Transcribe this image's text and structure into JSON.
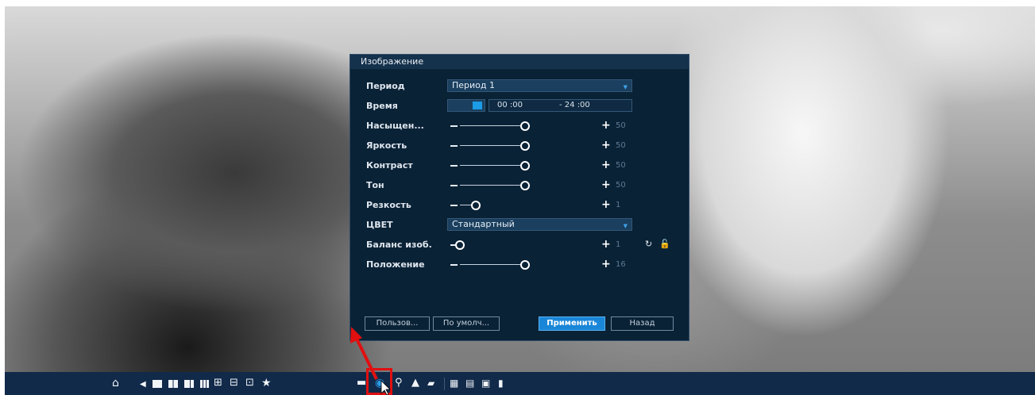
{
  "dialog": {
    "title": "Изображение",
    "rows": {
      "period": {
        "label": "Период",
        "value": "Период 1"
      },
      "time": {
        "label": "Время",
        "start": "00 :00",
        "end": "- 24 :00",
        "toggle_on": true
      },
      "saturation": {
        "label": "Насыщен...",
        "value": "50",
        "level": 0.5
      },
      "brightness": {
        "label": "Яркость",
        "value": "50",
        "level": 0.5
      },
      "contrast": {
        "label": "Контраст",
        "value": "50",
        "level": 0.5
      },
      "hue": {
        "label": "Тон",
        "value": "50",
        "level": 0.5
      },
      "sharpness": {
        "label": "Резкость",
        "value": "1",
        "level": 0.12
      },
      "color": {
        "label": "ЦВЕТ",
        "value": "Стандартный"
      },
      "white_balance": {
        "label": "Баланс изоб.",
        "value": "1",
        "level": 0.0
      },
      "position": {
        "label": "Положение",
        "value": "16",
        "level": 0.5
      }
    },
    "buttons": {
      "custom": "Пользов...",
      "default": "По умолч...",
      "apply": "Применить",
      "back": "Назад"
    }
  },
  "taskbar": {
    "icons": [
      "home-icon",
      "back-arrow-icon",
      "layout-1-icon",
      "layout-4-icon",
      "layout-8-icon",
      "layout-9-icon",
      "layout-16-icon",
      "layout-split-icon",
      "layout-custom-icon",
      "favorite-star-icon",
      "hdd-icon",
      "image-settings-icon",
      "search-icon",
      "alarm-warning-icon",
      "camera-icon",
      "network-icon",
      "settings-tiles-icon",
      "disk-icon",
      "info-icon"
    ]
  },
  "colors": {
    "dialog_bg": "#0a2236",
    "accent": "#1a86d8",
    "taskbar_bg": "#112a4a",
    "highlight": "#e01010"
  }
}
